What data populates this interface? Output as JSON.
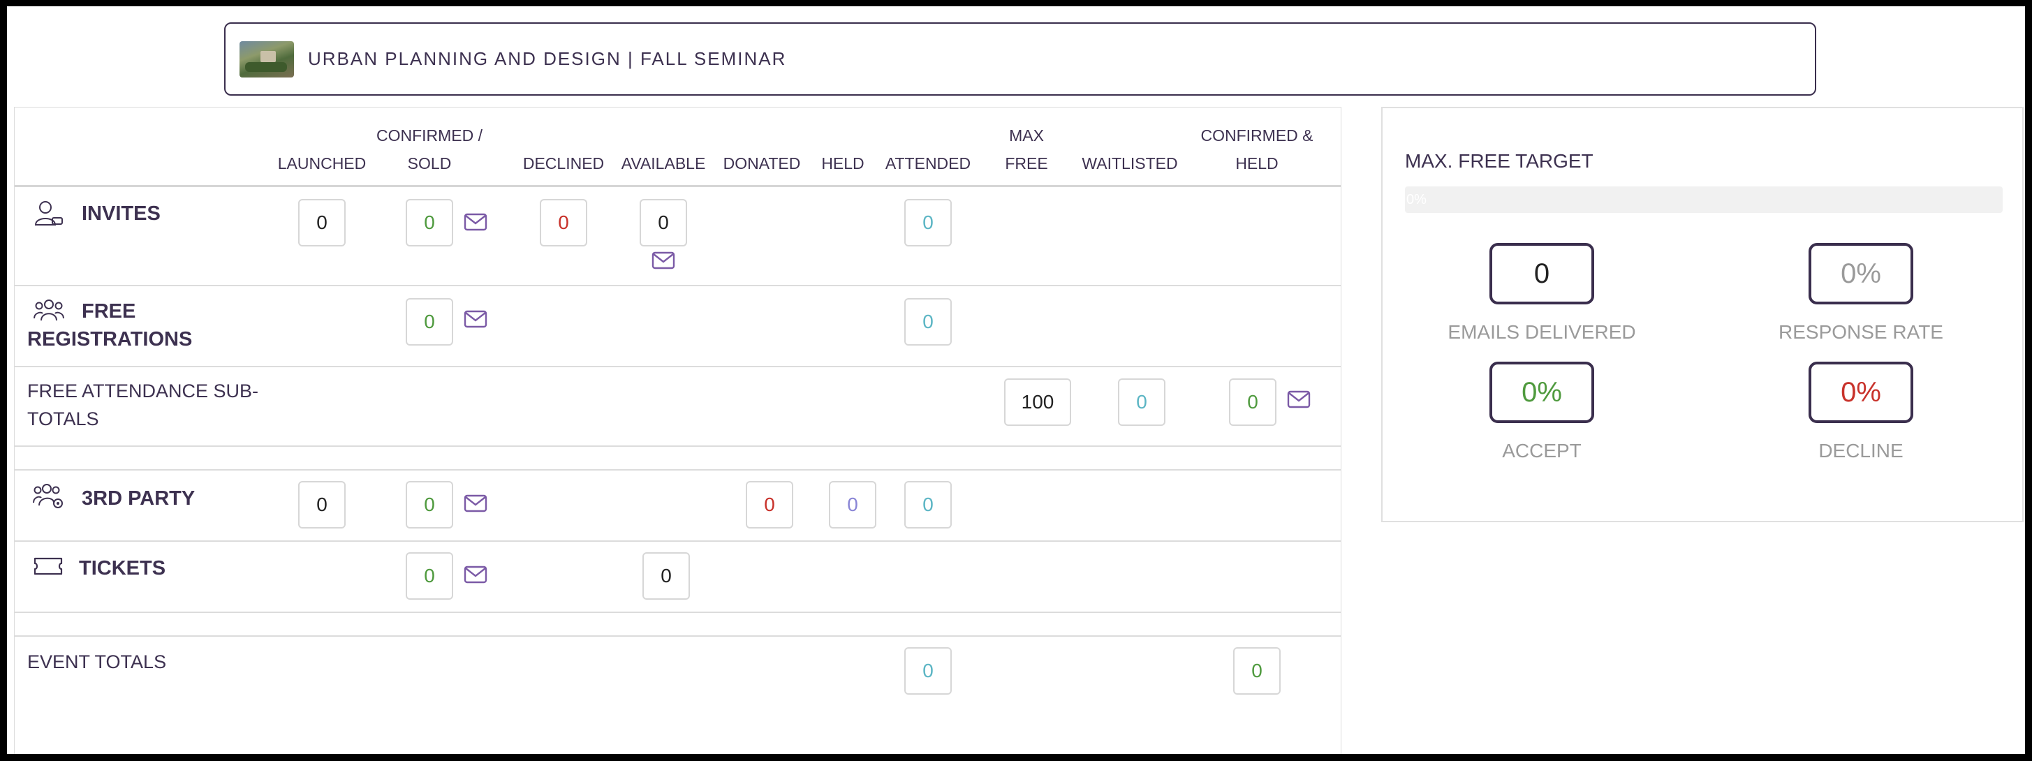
{
  "header": {
    "title": "URBAN PLANNING AND DESIGN | FALL SEMINAR",
    "thumbnail": "campus-photo"
  },
  "columns": [
    {
      "line1": "",
      "line2": "LAUNCHED"
    },
    {
      "line1": "CONFIRMED /",
      "line2": "SOLD"
    },
    {
      "line1": "",
      "line2": "DECLINED"
    },
    {
      "line1": "",
      "line2": "AVAILABLE"
    },
    {
      "line1": "",
      "line2": "DONATED"
    },
    {
      "line1": "",
      "line2": "HELD"
    },
    {
      "line1": "",
      "line2": "ATTENDED"
    },
    {
      "line1": "MAX",
      "line2": "FREE"
    },
    {
      "line1": "",
      "line2": "WAITLISTED"
    },
    {
      "line1": "CONFIRMED &",
      "line2": "HELD"
    }
  ],
  "rows": {
    "invites": {
      "label": "INVITES",
      "icon": "user-icon",
      "launched": "0",
      "confirmed": "0",
      "declined": "0",
      "available": "0",
      "attended": "0"
    },
    "free_registrations": {
      "label_line1": "FREE",
      "label_line2": "REGISTRATIONS",
      "icon": "users-icon",
      "confirmed": "0",
      "attended": "0"
    },
    "free_attendance": {
      "label_line1": "FREE ATTENDANCE SUB-",
      "label_line2": "TOTALS",
      "max_free": "100",
      "waitlisted": "0",
      "confirmed_held": "0"
    },
    "third_party": {
      "label": "3RD PARTY",
      "icon": "users-gear-icon",
      "launched": "0",
      "confirmed": "0",
      "donated": "0",
      "held": "0",
      "attended": "0"
    },
    "tickets": {
      "label": "TICKETS",
      "icon": "ticket-icon",
      "confirmed": "0",
      "available": "0"
    },
    "event_totals": {
      "label": "EVENT TOTALS",
      "attended": "0",
      "confirmed_held": "0"
    }
  },
  "stats": {
    "target_title": "MAX. FREE TARGET",
    "progress_percent": 0,
    "progress_label": "0%",
    "emails_delivered": {
      "value": "0",
      "label": "EMAILS DELIVERED"
    },
    "response_rate": {
      "value": "0%",
      "label": "RESPONSE RATE"
    },
    "accept": {
      "value": "0%",
      "label": "ACCEPT"
    },
    "decline": {
      "value": "0%",
      "label": "DECLINE"
    }
  },
  "colors": {
    "text": "#3d3150",
    "green": "#4f9a3e",
    "red": "#c8322b",
    "teal": "#5bb5c4",
    "lavender": "#8a86d6",
    "purple": "#7b5aa6",
    "gray": "#9a9a9a"
  }
}
